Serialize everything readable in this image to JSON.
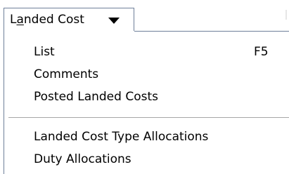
{
  "menubar": {
    "menu": {
      "label_pre": "L",
      "label_mnemonic": "a",
      "label_post": "nded Cost",
      "icon": "chevron-down-icon"
    }
  },
  "dropdown": {
    "items": [
      {
        "label": "List",
        "shortcut": "F5"
      },
      {
        "label": "Comments"
      },
      {
        "label": "Posted Landed Costs"
      },
      {
        "label": "Landed Cost Type Allocations"
      },
      {
        "label": "Duty Allocations"
      }
    ]
  },
  "colors": {
    "border": "#6e7f99",
    "separator": "#a6a6a6",
    "background": "#ffffff"
  }
}
